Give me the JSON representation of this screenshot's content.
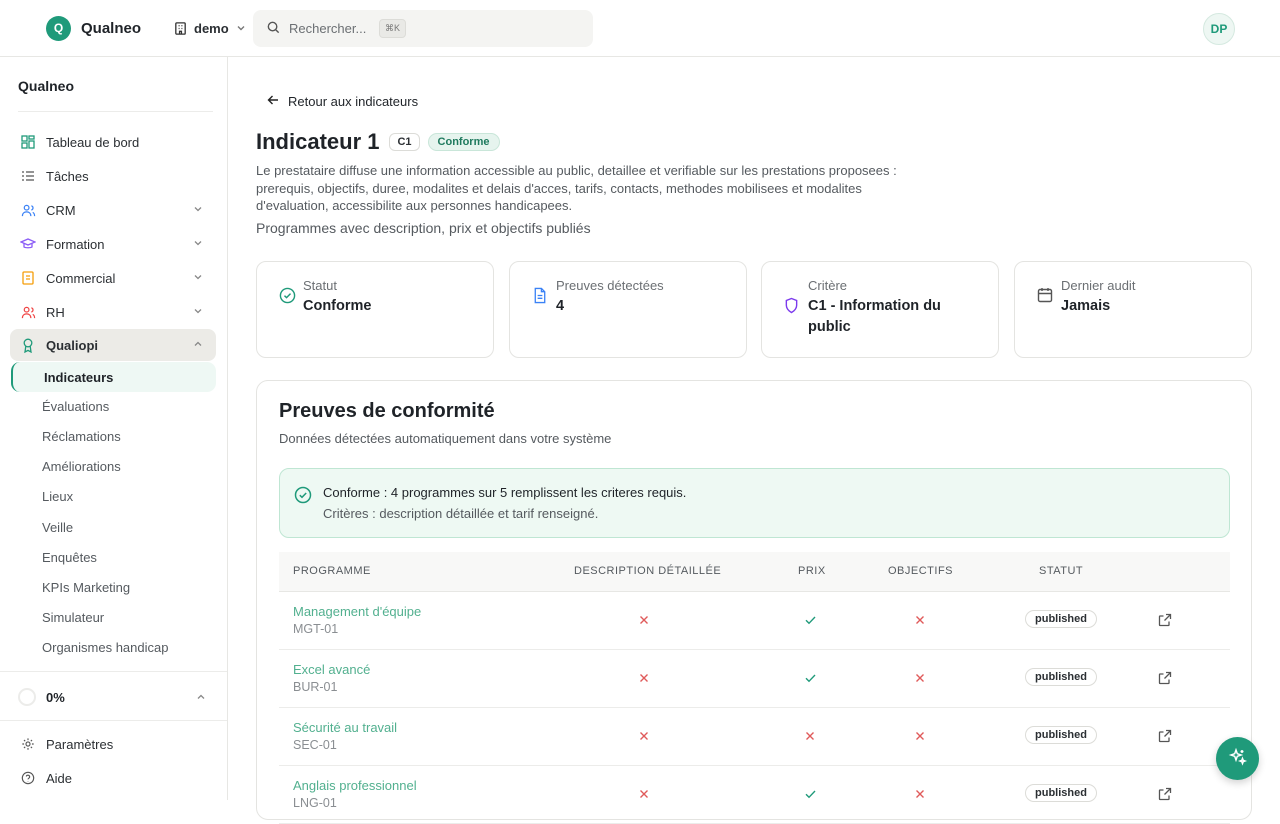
{
  "app": {
    "logo_letter": "Q",
    "name": "Qualneo"
  },
  "org": {
    "name": "demo"
  },
  "search": {
    "placeholder": "Rechercher...",
    "shortcut": "⌘K"
  },
  "user": {
    "initials": "DP"
  },
  "sidebar": {
    "title": "Qualneo",
    "items": [
      {
        "label": "Tableau de bord",
        "icon": "dashboard-icon"
      },
      {
        "label": "Tâches",
        "icon": "tasks-icon"
      },
      {
        "label": "CRM",
        "icon": "users-icon"
      },
      {
        "label": "Formation",
        "icon": "graduation-cap-icon"
      },
      {
        "label": "Commercial",
        "icon": "document-icon"
      },
      {
        "label": "RH",
        "icon": "team-icon"
      },
      {
        "label": "Qualiopi",
        "icon": "award-icon"
      }
    ],
    "qualiopi_sub": [
      "Indicateurs",
      "Évaluations",
      "Réclamations",
      "Améliorations",
      "Lieux",
      "Veille",
      "Enquêtes",
      "KPIs Marketing",
      "Simulateur",
      "Organismes handicap"
    ],
    "progress": "0%",
    "settings": "Paramètres",
    "help": "Aide"
  },
  "page": {
    "back": "Retour aux indicateurs",
    "title": "Indicateur 1",
    "code": "C1",
    "status_badge": "Conforme",
    "description": "Le prestataire diffuse une information accessible au public, detaillee et verifiable sur les prestations proposees : prerequis, objectifs, duree, modalites et delais d'acces, tarifs, contacts, methodes mobilisees et modalites d'evaluation, accessibilite aux personnes handicapees.",
    "subdescription": "Programmes avec description, prix et objectifs publiés"
  },
  "cards": [
    {
      "label": "Statut",
      "value": "Conforme"
    },
    {
      "label": "Preuves détectées",
      "value": "4"
    },
    {
      "label": "Critère",
      "value": "C1 - Information du public"
    },
    {
      "label": "Dernier audit",
      "value": "Jamais"
    }
  ],
  "proofs": {
    "title": "Preuves de conformité",
    "subtitle": "Données détectées automatiquement dans votre système",
    "alert_main": "Conforme : 4 programmes sur 5 remplissent les criteres requis.",
    "alert_sub": "Critères : description détaillée et tarif renseigné.",
    "columns": [
      "PROGRAMME",
      "DESCRIPTION DÉTAILLÉE",
      "PRIX",
      "OBJECTIFS",
      "STATUT"
    ],
    "rows": [
      {
        "name": "Management d'équipe",
        "code": "MGT-01",
        "description": false,
        "prix": true,
        "objectifs": false,
        "status": "published"
      },
      {
        "name": "Excel avancé",
        "code": "BUR-01",
        "description": false,
        "prix": true,
        "objectifs": false,
        "status": "published"
      },
      {
        "name": "Sécurité au travail",
        "code": "SEC-01",
        "description": false,
        "prix": false,
        "objectifs": false,
        "status": "published"
      },
      {
        "name": "Anglais professionnel",
        "code": "LNG-01",
        "description": false,
        "prix": true,
        "objectifs": false,
        "status": "published"
      }
    ]
  },
  "colors": {
    "accent": "#1f9a7a",
    "link": "#52b08f",
    "error": "#e05a5a",
    "success": "#1f9a7a"
  }
}
